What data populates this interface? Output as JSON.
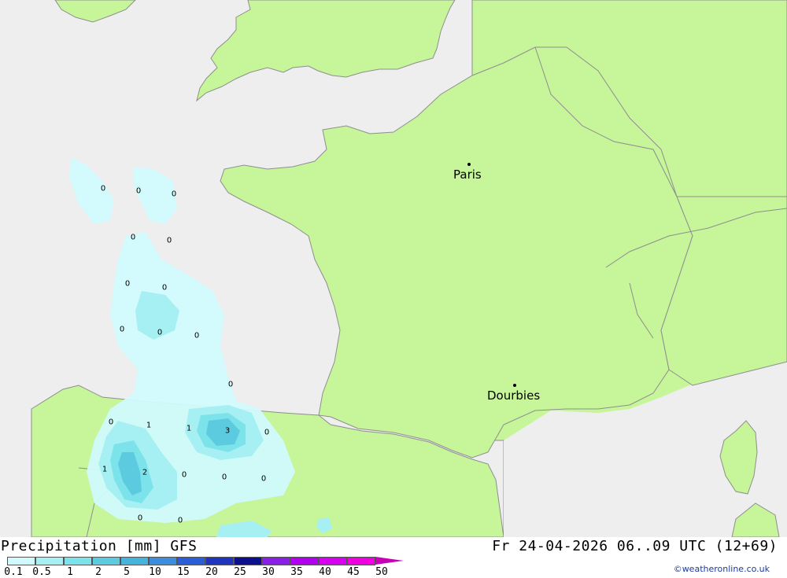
{
  "map": {
    "colors": {
      "sea": "#eeeeee",
      "land": "#c6f59a",
      "border": "#8e8e8e",
      "precip_light": "#d1fafc",
      "precip_mid": "#a6f0f3",
      "precip_high": "#7de3ea",
      "precip_peak": "#5ccbe0"
    },
    "cities": [
      {
        "name": "Paris"
      },
      {
        "name": "Dourbies"
      }
    ],
    "values": [
      "0",
      "0",
      "0",
      "0",
      "0",
      "0",
      "0",
      "0",
      "0",
      "0",
      "0",
      "0",
      "0",
      "1",
      "1",
      "3",
      "0",
      "1",
      "2",
      "0",
      "0",
      "0",
      "0",
      "0"
    ]
  },
  "footer": {
    "title": "Precipitation [mm] GFS",
    "datetime": "Fr 24-04-2026 06..09 UTC (12+69)",
    "credit": "©weatheronline.co.uk",
    "scale": {
      "labels": [
        "0.1",
        "0.5",
        "1",
        "2",
        "5",
        "10",
        "15",
        "20",
        "25",
        "30",
        "35",
        "40",
        "45",
        "50"
      ],
      "colors": [
        "#d1fafc",
        "#a6f0f3",
        "#7de3ea",
        "#5ccbe0",
        "#44b4dc",
        "#3c8ce0",
        "#2a5ed8",
        "#1e34c0",
        "#0a1090",
        "#8a20e8",
        "#b100f0",
        "#d800f0",
        "#f000e0",
        "#c800b8"
      ]
    }
  }
}
